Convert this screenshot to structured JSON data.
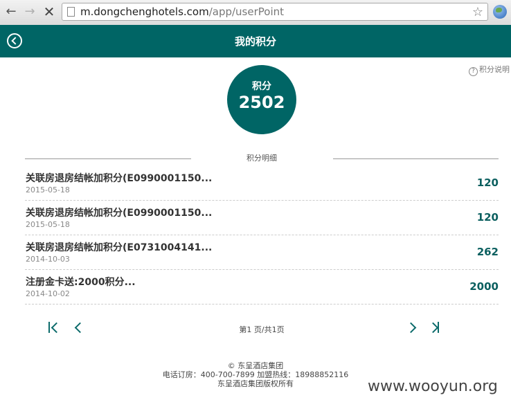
{
  "browser": {
    "url_host": "m.dongchenghotels.com",
    "url_path": "/app/userPoint"
  },
  "header": {
    "title": "我的积分"
  },
  "help": {
    "label": "积分说明"
  },
  "points": {
    "label": "积分",
    "value": "2502"
  },
  "detail": {
    "heading": "积分明细",
    "records": [
      {
        "title": "关联房退房结帐加积分(E0990001150...",
        "date": "2015-05-18",
        "points": "120"
      },
      {
        "title": "关联房退房结帐加积分(E0990001150...",
        "date": "2015-05-18",
        "points": "120"
      },
      {
        "title": "关联房退房结帐加积分(E0731004141...",
        "date": "2014-10-03",
        "points": "262"
      },
      {
        "title": "注册金卡送:2000积分...",
        "date": "2014-10-02",
        "points": "2000"
      }
    ]
  },
  "pager": {
    "info": "第1 页/共1页"
  },
  "footer": {
    "copyright": "© 东呈酒店集团",
    "contact": "电话订房：400-700-7899   加盟热线：18988852116",
    "rights": "东呈酒店集团版权所有"
  },
  "watermark": "www.wooyun.org"
}
